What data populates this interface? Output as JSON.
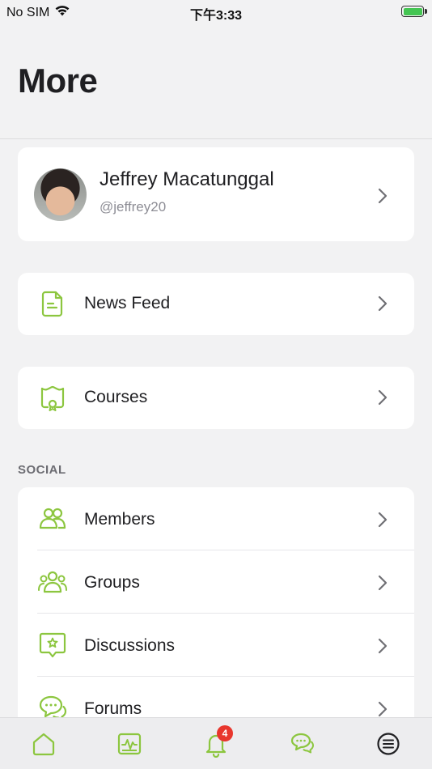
{
  "status_bar": {
    "carrier": "No SIM",
    "time": "下午3:33"
  },
  "page": {
    "title": "More"
  },
  "profile": {
    "name": "Jeffrey Macatunggal",
    "handle": "@jeffrey20"
  },
  "menu": {
    "news_feed": "News Feed",
    "courses": "Courses"
  },
  "social": {
    "section_label": "SOCIAL",
    "items": [
      {
        "label": "Members",
        "icon": "members-icon"
      },
      {
        "label": "Groups",
        "icon": "groups-icon"
      },
      {
        "label": "Discussions",
        "icon": "discussions-icon"
      },
      {
        "label": "Forums",
        "icon": "forums-icon"
      }
    ]
  },
  "tab_bar": {
    "notifications_badge": "4",
    "tabs": [
      "home-icon",
      "activity-icon",
      "notifications-icon",
      "messages-icon",
      "more-icon"
    ]
  },
  "colors": {
    "accent": "#8cc63f",
    "badge": "#e8362d",
    "background": "#f2f2f3"
  }
}
